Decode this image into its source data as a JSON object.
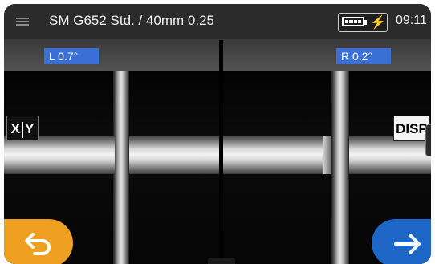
{
  "header": {
    "menu_icon": "hamburger-menu-icon",
    "title": "SM G652 Std. / 40mm 0.25",
    "battery_icon": "battery-charging-icon",
    "time": "09:11"
  },
  "fiber_view": {
    "left_angle": "L  0.7°",
    "right_angle": "R  0.2°"
  },
  "controls": {
    "xy_left": "X",
    "xy_right": "Y",
    "disp_label": "DISP",
    "back_icon": "back-arrow-icon",
    "next_icon": "next-arrow-icon"
  },
  "colors": {
    "accent_blue": "#1f67c6",
    "accent_orange": "#f0a020",
    "angle_badge": "#3a6fd8"
  }
}
